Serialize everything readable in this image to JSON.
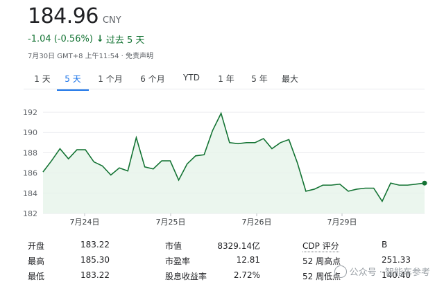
{
  "quote": {
    "price": "184.96",
    "currency": "CNY",
    "change": "-1.04 (-0.56%)",
    "change_arrow": "↓",
    "change_period": "过去 5 天",
    "meta": "7月30日 GMT+8 上午11:54 · 免责声明"
  },
  "tabs": [
    {
      "label": "1 天",
      "active": false
    },
    {
      "label": "5 天",
      "active": true
    },
    {
      "label": "1 个月",
      "active": false
    },
    {
      "label": "6 个月",
      "active": false
    },
    {
      "label": "YTD",
      "active": false
    },
    {
      "label": "1 年",
      "active": false
    },
    {
      "label": "5 年",
      "active": false
    },
    {
      "label": "最大",
      "active": false
    }
  ],
  "chart_data": {
    "type": "area",
    "y_ticks": [
      "192",
      "190",
      "188",
      "186",
      "184",
      "182"
    ],
    "ylim": [
      182,
      192
    ],
    "x_ticks": [
      "7月24日",
      "7月25日",
      "7月26日",
      "7月29日"
    ],
    "line_color": "#137333",
    "fill_color": "#e6f4ea",
    "grid": true,
    "series": [
      {
        "values": [
          186.1,
          187.2,
          188.4,
          187.4,
          188.3,
          188.3,
          187.1,
          186.7,
          185.8,
          186.5,
          186.2,
          189.5,
          186.6,
          186.4,
          187.2,
          187.2,
          185.3,
          186.9,
          187.7,
          187.8,
          190.2,
          191.9,
          189.0,
          188.9,
          189.0,
          189.0,
          189.4,
          188.4,
          189.0,
          189.3,
          187.0,
          184.2,
          184.4,
          184.8,
          184.8,
          184.9,
          184.2,
          184.4,
          184.5,
          184.5,
          183.2,
          185.0,
          184.8,
          184.8,
          184.9,
          185.0
        ]
      }
    ]
  },
  "stats": {
    "col1": [
      {
        "label": "开盘",
        "value": "183.22"
      },
      {
        "label": "最高",
        "value": "185.30"
      },
      {
        "label": "最低",
        "value": "183.22"
      }
    ],
    "col2": [
      {
        "label": "市值",
        "value": "8329.14亿"
      },
      {
        "label": "市盈率",
        "value": "12.81"
      },
      {
        "label": "股息收益率",
        "value": "2.72%"
      }
    ],
    "col3": [
      {
        "label": "CDP 评分",
        "value": "B"
      },
      {
        "label": "52 周高点",
        "value": "251.33"
      },
      {
        "label": "52 周低点",
        "value": "140.40"
      }
    ]
  },
  "watermark": {
    "text": "公众号 · 智能车参考",
    "icon": "wechat-icon"
  }
}
